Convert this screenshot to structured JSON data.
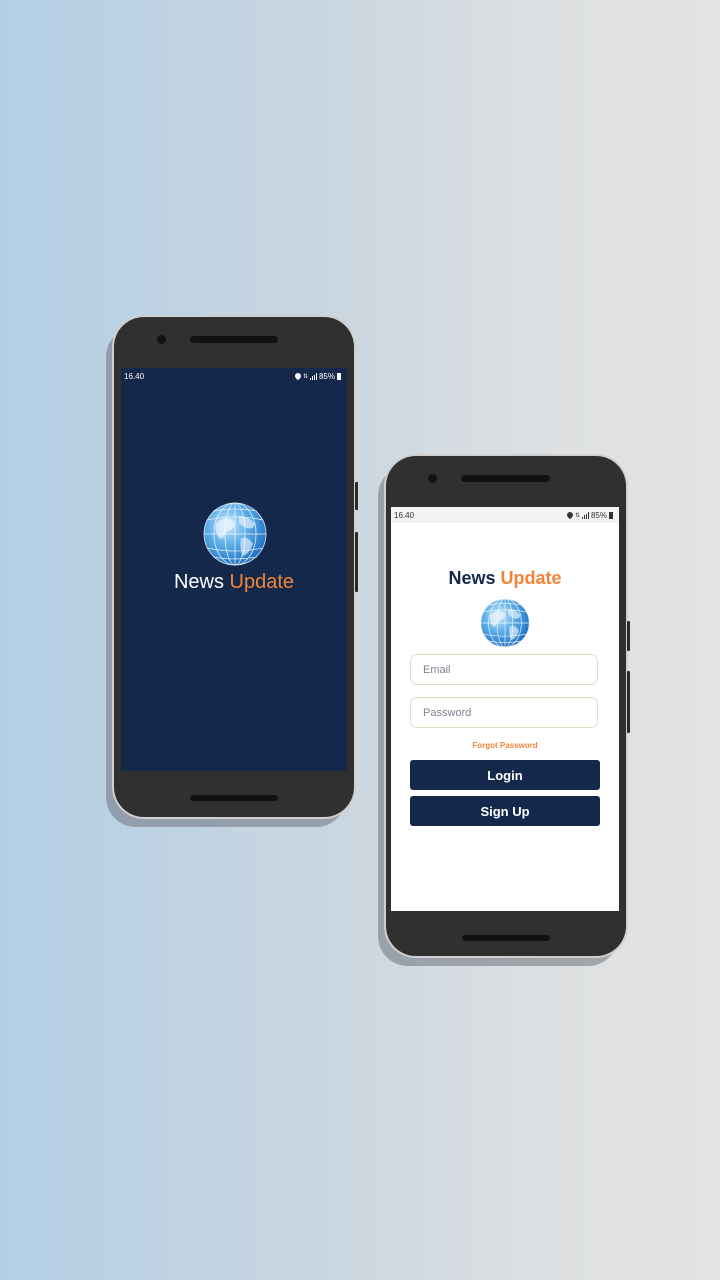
{
  "splash": {
    "status": {
      "time": "16.40",
      "battery": "85%"
    },
    "brand": {
      "word1": "News",
      "word2": "Update"
    },
    "logo_icon": "globe-icon"
  },
  "login": {
    "status": {
      "time": "16.40",
      "battery": "85%"
    },
    "brand": {
      "word1": "News",
      "word2": "Update"
    },
    "logo_icon": "globe-icon",
    "email": {
      "placeholder": "Email",
      "value": ""
    },
    "password": {
      "placeholder": "Password",
      "value": ""
    },
    "forgot_label": "Forgot Password",
    "login_label": "Login",
    "signup_label": "Sign Up"
  },
  "colors": {
    "navy": "#14284b",
    "accent_orange": "#f08438",
    "white": "#ffffff"
  }
}
